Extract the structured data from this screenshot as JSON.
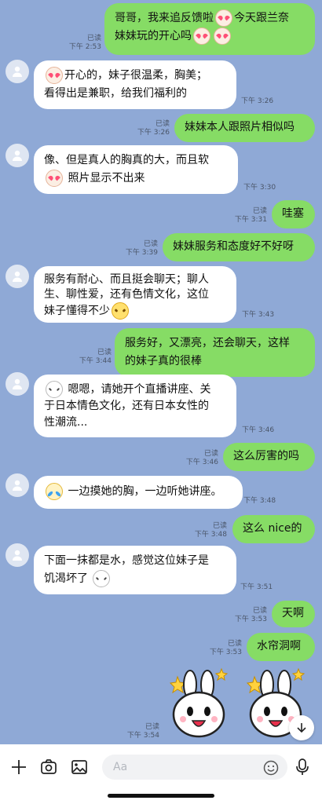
{
  "chat": {
    "messages": [
      {
        "dir": "out",
        "lines": [
          "哥哥，我来追反馈啦{emo}今天跟兰奈",
          "妹妹玩的开心吗{emo}{emo}"
        ],
        "status": "已读",
        "time": "下午 2:53"
      },
      {
        "dir": "in",
        "lines": [
          "{emo}开心的，妹子很温柔，胸美；",
          "看得出是兼职，给我们福利的"
        ],
        "time": "下午 3:26"
      },
      {
        "dir": "out",
        "lines": [
          "妹妹本人跟照片相似吗"
        ],
        "status": "已读",
        "time": "下午 3:26"
      },
      {
        "dir": "in",
        "lines": [
          "像、但是真人的胸真的大，而且软",
          "{emo} 照片显示不出来"
        ],
        "time": "下午 3:30"
      },
      {
        "dir": "out",
        "lines": [
          "哇塞"
        ],
        "status": "已读",
        "time": "下午 3:31"
      },
      {
        "dir": "out",
        "lines": [
          "妹妹服务和态度好不好呀"
        ],
        "status": "已读",
        "time": "下午 3:39"
      },
      {
        "dir": "in",
        "lines": [
          "服务有耐心、而且挺会聊天；聊人",
          "生、聊性爱，还有色情文化，这位",
          "妹子懂得不少{emo}"
        ],
        "time": "下午 3:43"
      },
      {
        "dir": "out",
        "lines": [
          "服务好，又漂亮，还会聊天，这样",
          "的妹子真的很棒"
        ],
        "status": "已读",
        "time": "下午 3:44"
      },
      {
        "dir": "in",
        "lines": [
          "{emo} 嗯嗯，请她开个直播讲座、关",
          "于日本情色文化，还有日本女性的",
          "性潮流..."
        ],
        "time": "下午 3:46"
      },
      {
        "dir": "out",
        "lines": [
          "这么厉害的吗"
        ],
        "status": "已读",
        "time": "下午 3:46"
      },
      {
        "dir": "in",
        "lines": [
          "{emo} 一边摸她的胸，一边听她讲座。"
        ],
        "time": "下午 3:48"
      },
      {
        "dir": "out",
        "lines": [
          "这么 nice的"
        ],
        "status": "已读",
        "time": "下午 3:48"
      },
      {
        "dir": "in",
        "lines": [
          "下面一抹都是水，感觉这位妹子是",
          "饥渴坏了 {emo}"
        ],
        "time": "下午 3:51"
      },
      {
        "dir": "out",
        "lines": [
          "天啊"
        ],
        "status": "已读",
        "time": "下午 3:53"
      },
      {
        "dir": "out",
        "lines": [
          "水帘洞啊"
        ],
        "status": "已读",
        "time": "下午 3:53"
      },
      {
        "dir": "out_sticker",
        "status": "已读",
        "time": "下午 3:54"
      }
    ]
  },
  "input_bar": {
    "placeholder": "Aa"
  },
  "colors": {
    "background": "#8fa9d6",
    "incoming_bubble": "#ffffff",
    "outgoing_bubble": "#86dc65"
  }
}
